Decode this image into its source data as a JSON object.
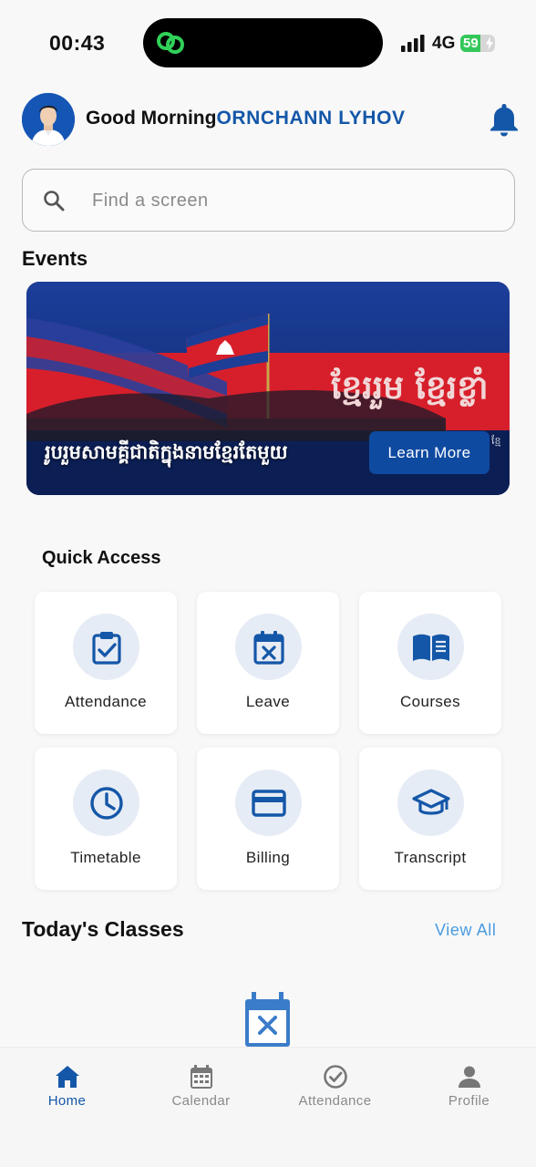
{
  "status_bar": {
    "time": "00:43",
    "network": "4G",
    "battery": "59",
    "battery_level": 0.59
  },
  "header": {
    "greeting": "Good Morning",
    "user_name": "ORNCHANN LYHOV"
  },
  "search": {
    "placeholder": "Find a screen"
  },
  "events": {
    "title": "Events",
    "banner": {
      "caption": "រូបរួមសាមគ្គីជាតិក្នុងនាមខ្មែរតែមួយ",
      "overlay_text": "ខ្មែររួម ខ្មែរខ្លាំ",
      "overlay_small": "ខ្មែ",
      "button_label": "Learn More"
    }
  },
  "quick_access": {
    "title": "Quick Access",
    "items": [
      {
        "label": "Attendance",
        "icon": "clipboard-check-icon"
      },
      {
        "label": "Leave",
        "icon": "calendar-x-icon"
      },
      {
        "label": "Courses",
        "icon": "open-book-icon"
      },
      {
        "label": "Timetable",
        "icon": "clock-icon"
      },
      {
        "label": "Billing",
        "icon": "credit-card-icon"
      },
      {
        "label": "Transcript",
        "icon": "graduation-cap-icon"
      }
    ]
  },
  "todays_classes": {
    "title": "Today's Classes",
    "view_all": "View All"
  },
  "bottom_nav": {
    "items": [
      {
        "label": "Home",
        "icon": "home-icon",
        "active": true
      },
      {
        "label": "Calendar",
        "icon": "calendar-icon",
        "active": false
      },
      {
        "label": "Attendance",
        "icon": "check-circle-icon",
        "active": false
      },
      {
        "label": "Profile",
        "icon": "person-icon",
        "active": false
      }
    ]
  },
  "colors": {
    "primary": "#1457a8",
    "accent_link": "#4a9be0",
    "icon_bg": "#e6ecf5",
    "battery_green": "#34c759"
  }
}
